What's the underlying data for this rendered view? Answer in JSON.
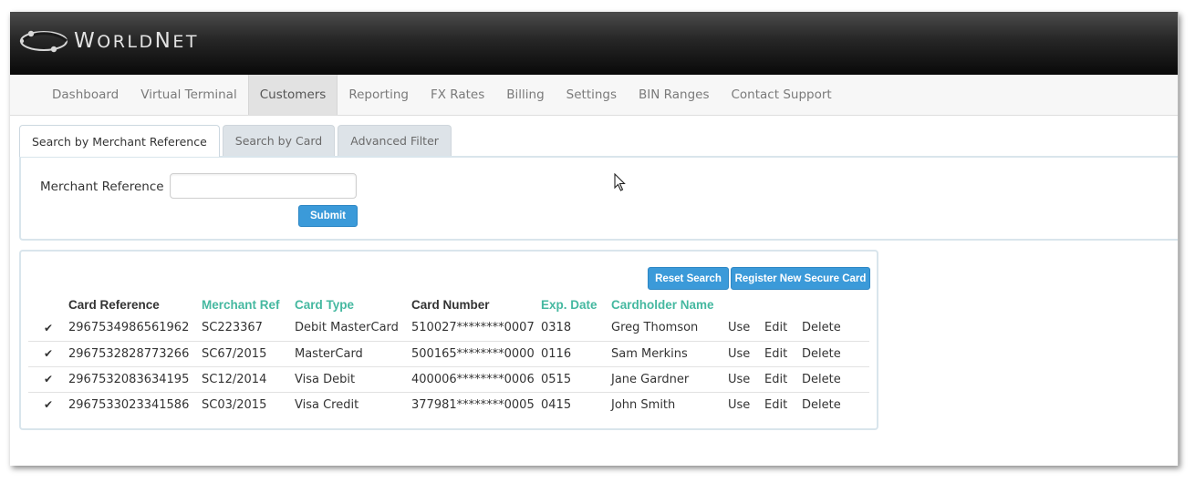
{
  "header": {
    "logo_text": "WorldNet"
  },
  "nav": {
    "items": [
      {
        "label": "Dashboard",
        "active": false
      },
      {
        "label": "Virtual Terminal",
        "active": false
      },
      {
        "label": "Customers",
        "active": true
      },
      {
        "label": "Reporting",
        "active": false
      },
      {
        "label": "FX Rates",
        "active": false
      },
      {
        "label": "Billing",
        "active": false
      },
      {
        "label": "Settings",
        "active": false
      },
      {
        "label": "BIN Ranges",
        "active": false
      },
      {
        "label": "Contact Support",
        "active": false
      }
    ]
  },
  "tabs": [
    {
      "label": "Search by Merchant Reference",
      "active": true
    },
    {
      "label": "Search by Card",
      "active": false
    },
    {
      "label": "Advanced Filter",
      "active": false
    }
  ],
  "search": {
    "label": "Merchant Reference",
    "value": "",
    "submit_label": "Submit"
  },
  "results": {
    "reset_label": "Reset Search",
    "register_label": "Register New Secure Card",
    "columns": [
      {
        "label": "Card Reference",
        "sortable": false
      },
      {
        "label": "Merchant Ref",
        "sortable": true
      },
      {
        "label": "Card Type",
        "sortable": true
      },
      {
        "label": "Card Number",
        "sortable": false
      },
      {
        "label": "Exp. Date",
        "sortable": true
      },
      {
        "label": "Cardholder Name",
        "sortable": true
      }
    ],
    "actions": [
      "Use",
      "Edit",
      "Delete"
    ],
    "rows": [
      {
        "card_reference": "2967534986561962",
        "merchant_ref": "SC223367",
        "card_type": "Debit MasterCard",
        "card_number": "510027********0007",
        "exp_date": "0318",
        "cardholder": "Greg Thomson"
      },
      {
        "card_reference": "2967532828773266",
        "merchant_ref": "SC67/2015",
        "card_type": "MasterCard",
        "card_number": "500165********0000",
        "exp_date": "0116",
        "cardholder": "Sam Merkins"
      },
      {
        "card_reference": "2967532083634195",
        "merchant_ref": "SC12/2014",
        "card_type": "Visa Debit",
        "card_number": "400006********0006",
        "exp_date": "0515",
        "cardholder": "Jane Gardner"
      },
      {
        "card_reference": "2967533023341586",
        "merchant_ref": "SC03/2015",
        "card_type": "Visa Credit",
        "card_number": "377981********0005",
        "exp_date": "0415",
        "cardholder": "John Smith"
      }
    ]
  },
  "colors": {
    "accent": "#45b8a0",
    "button": "#3b9ad9"
  }
}
